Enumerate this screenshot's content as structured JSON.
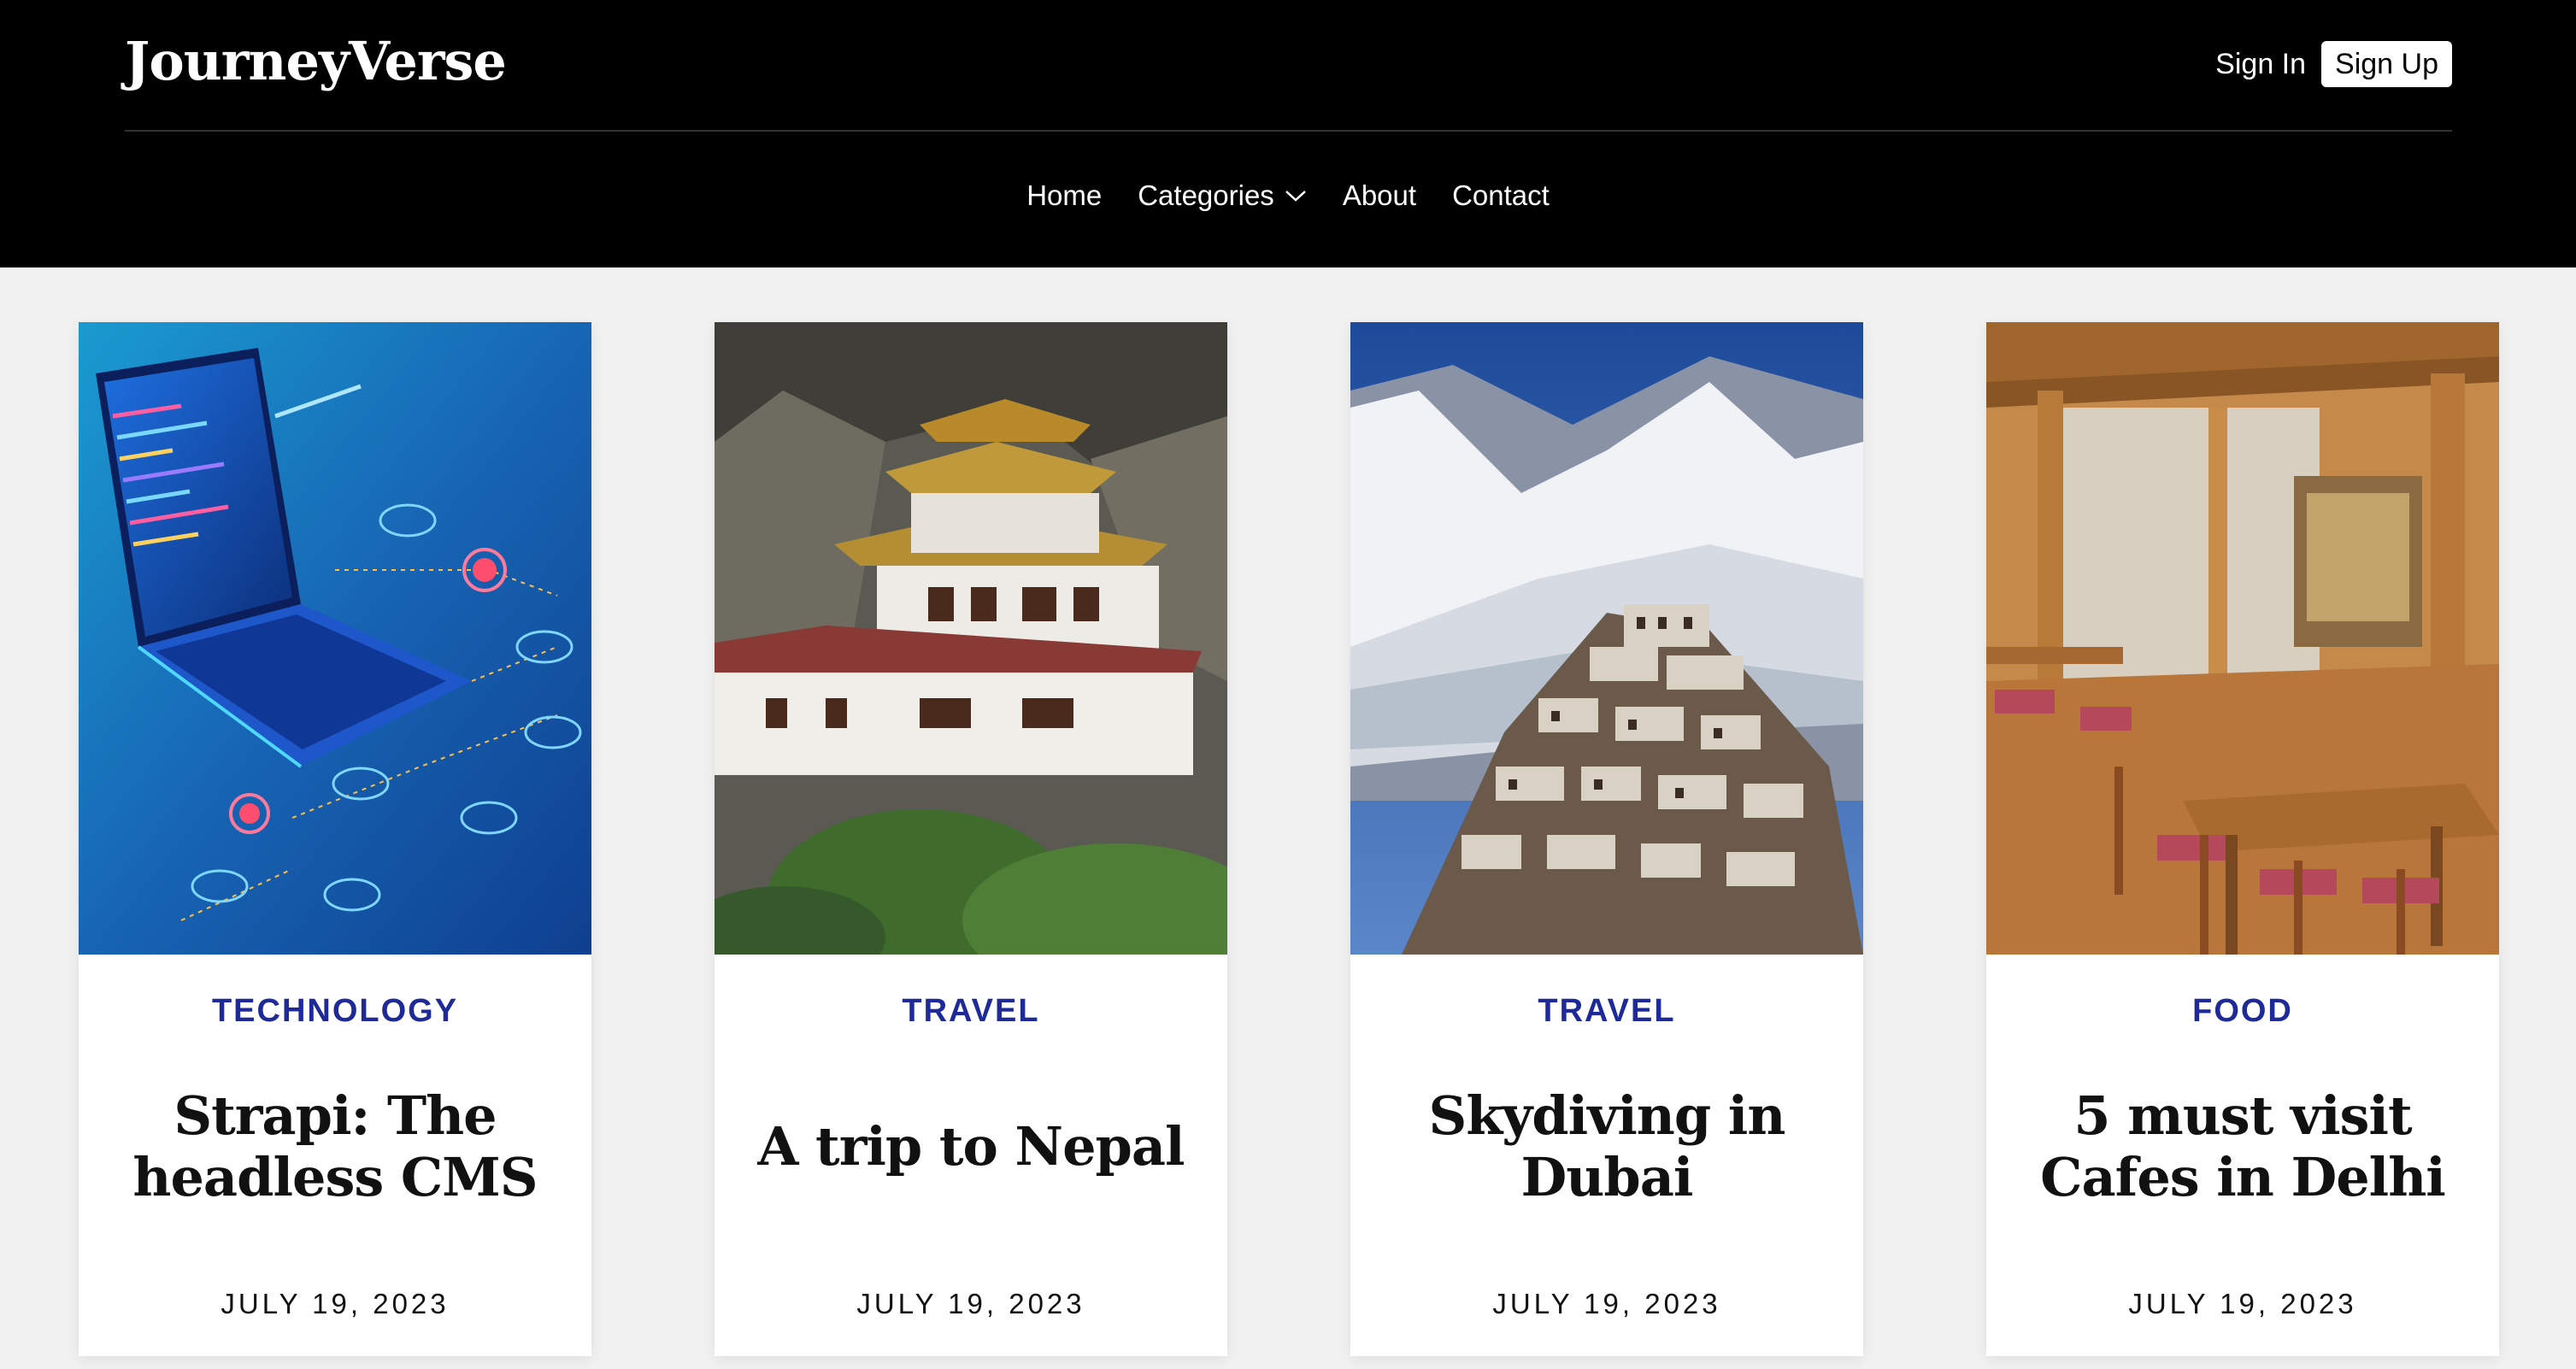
{
  "header": {
    "brand": "JourneyVerse",
    "sign_in": "Sign In",
    "sign_up": "Sign Up"
  },
  "nav": {
    "items": [
      {
        "label": "Home"
      },
      {
        "label": "Categories",
        "icon": "chevron-down-icon"
      },
      {
        "label": "About"
      },
      {
        "label": "Contact"
      }
    ]
  },
  "cards": [
    {
      "category": "TECHNOLOGY",
      "title": "Strapi: The headless CMS",
      "date": "JULY 19, 2023",
      "image": "laptop-tech-illustration"
    },
    {
      "category": "TRAVEL",
      "title": "A trip to Nepal",
      "date": "JULY 19, 2023",
      "image": "cliffside-monastery-photo"
    },
    {
      "category": "TRAVEL",
      "title": "Skydiving in Dubai",
      "date": "JULY 19, 2023",
      "image": "snowy-mountain-village-photo"
    },
    {
      "category": "FOOD",
      "title": "5 must visit Cafes in Delhi",
      "date": "JULY 19, 2023",
      "image": "wooden-cafe-interior-photo"
    }
  ],
  "colors": {
    "header_bg": "#000000",
    "page_bg": "#f1f1f1",
    "category_accent": "#1f2a99"
  }
}
